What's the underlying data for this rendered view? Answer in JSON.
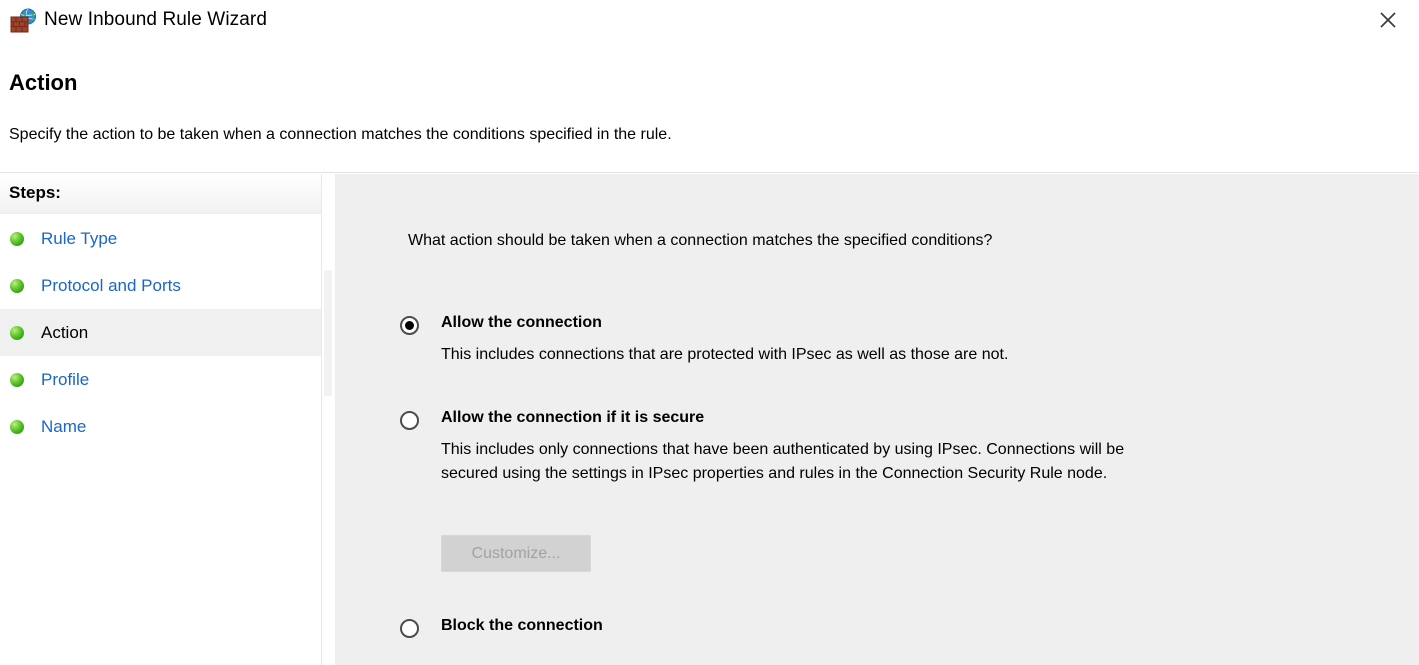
{
  "titlebar": {
    "icon": "firewall-globe-icon",
    "title": "New Inbound Rule Wizard",
    "close_label": "close-icon"
  },
  "header": {
    "title": "Action",
    "subtitle": "Specify the action to be taken when a connection matches the conditions specified in the rule."
  },
  "sidebar": {
    "heading": "Steps:",
    "items": [
      {
        "label": "Rule Type",
        "current": false
      },
      {
        "label": "Protocol and Ports",
        "current": false
      },
      {
        "label": "Action",
        "current": true
      },
      {
        "label": "Profile",
        "current": false
      },
      {
        "label": "Name",
        "current": false
      }
    ]
  },
  "main": {
    "question": "What action should be taken when a connection matches the specified conditions?",
    "options": [
      {
        "title": "Allow the connection",
        "description": "This includes connections that are protected with IPsec as well as those are not.",
        "selected": true
      },
      {
        "title": "Allow the connection if it is secure",
        "description": "This includes only connections that have been authenticated by using IPsec.  Connections will be secured using the settings in IPsec properties and rules in the Connection Security Rule node.",
        "selected": false
      },
      {
        "title": "Block the connection",
        "description": "",
        "selected": false
      }
    ],
    "customize_button": {
      "label": "Customize...",
      "disabled": true
    }
  },
  "colors": {
    "link": "#1a66c9",
    "content_bg": "#efefef",
    "sidebar_bg": "#ffffff",
    "current_step_bg": "#f0f0f0",
    "step_bullet": "#5cc42a",
    "disabled_text": "#a2a2a2"
  }
}
